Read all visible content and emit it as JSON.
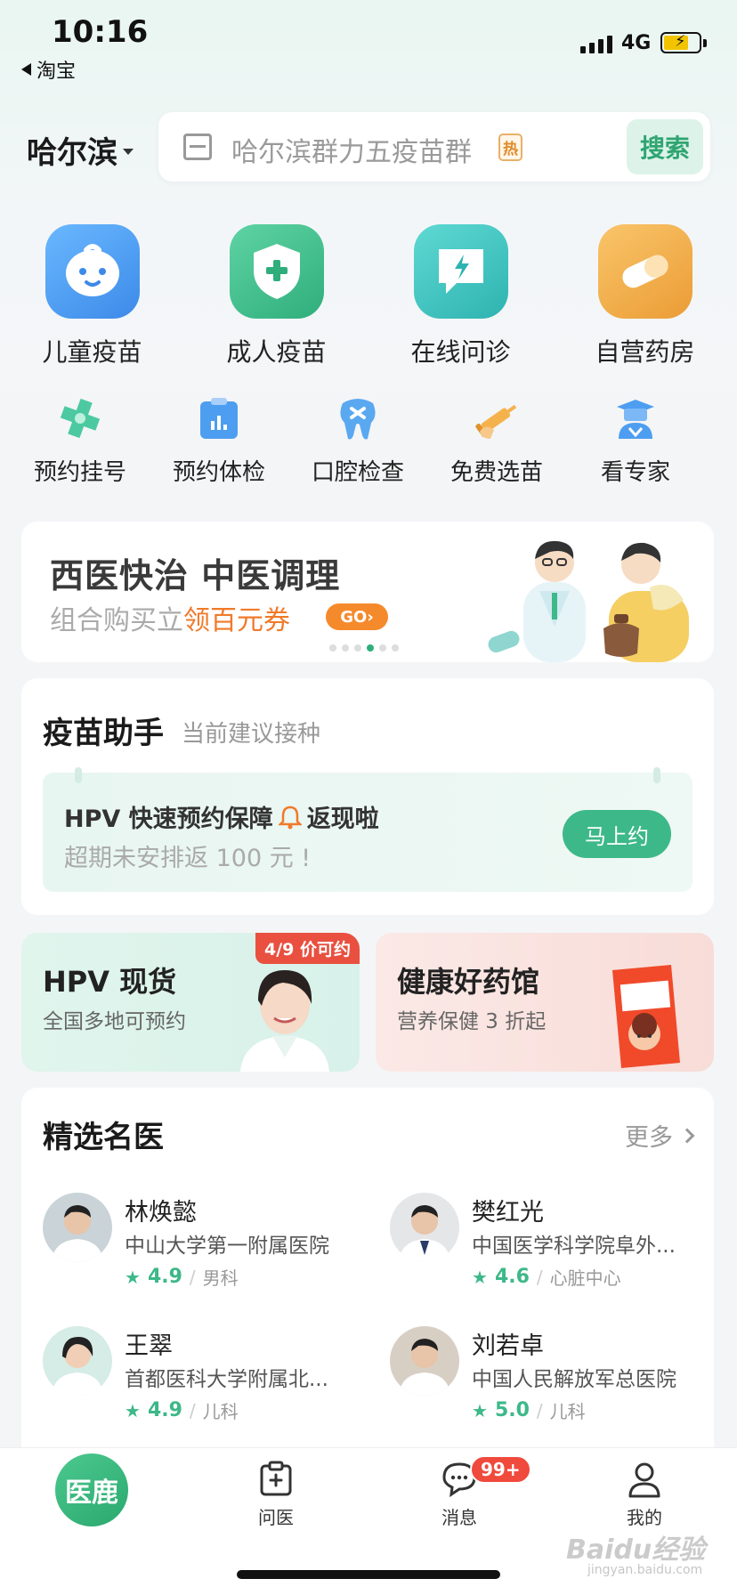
{
  "status_bar": {
    "time": "10:16",
    "back_app": "淘宝",
    "network": "4G"
  },
  "header": {
    "city": "哈尔滨",
    "search_placeholder": "哈尔滨群力五疫苗群",
    "hot_badge": "热",
    "search_button": "搜索"
  },
  "primary_entries": [
    {
      "label": "儿童疫苗",
      "icon": "baby-face-icon"
    },
    {
      "label": "成人疫苗",
      "icon": "shield-plus-icon"
    },
    {
      "label": "在线问诊",
      "icon": "chat-bolt-icon"
    },
    {
      "label": "自营药房",
      "icon": "pill-icon"
    }
  ],
  "secondary_entries": [
    {
      "label": "预约挂号",
      "icon": "medical-cross-icon"
    },
    {
      "label": "预约体检",
      "icon": "clipboard-chart-icon"
    },
    {
      "label": "口腔检查",
      "icon": "tooth-icon"
    },
    {
      "label": "免费选苗",
      "icon": "syringe-icon"
    },
    {
      "label": "看专家",
      "icon": "doctor-cap-icon"
    }
  ],
  "banner": {
    "title": "西医快治 中医调理",
    "sub_prefix": "组合购买立",
    "sub_highlight": "领百元券",
    "go": "GO›",
    "dots": 6,
    "active_dot": 3
  },
  "vaccine_assistant": {
    "title": "疫苗助手",
    "subtitle": "当前建议接种",
    "promo_line1": "HPV 快速预约保障",
    "promo_cashback": "返现啦",
    "promo_line2": "超期未安排返 100 元 !",
    "book_button": "马上约"
  },
  "cards": {
    "hpv": {
      "title": "HPV 现货",
      "subtitle": "全国多地可预约",
      "tag": "4/9 价可约"
    },
    "pharmacy": {
      "title": "健康好药馆",
      "subtitle": "营养保健 3 折起"
    }
  },
  "doctors": {
    "title": "精选名医",
    "more": "更多",
    "list": [
      {
        "name": "林焕懿",
        "hospital": "中山大学第一附属医院",
        "rating": "4.9",
        "department": "男科"
      },
      {
        "name": "樊红光",
        "hospital": "中国医学科学院阜外...",
        "rating": "4.6",
        "department": "心脏中心"
      },
      {
        "name": "王翠",
        "hospital": "首都医科大学附属北...",
        "rating": "4.9",
        "department": "儿科"
      },
      {
        "name": "刘若卓",
        "hospital": "中国人民解放军总医院",
        "rating": "5.0",
        "department": "儿科"
      }
    ]
  },
  "tabbar": {
    "home_logo": "医鹿",
    "ask_doctor": "问医",
    "messages": "消息",
    "messages_badge": "99+",
    "mine": "我的"
  },
  "watermark": {
    "text": "Baidu经验",
    "sub": "jingyan.baidu.com"
  },
  "colors": {
    "brand_green": "#3db889",
    "alert_red": "#f04a3d",
    "orange": "#f58a2c"
  }
}
